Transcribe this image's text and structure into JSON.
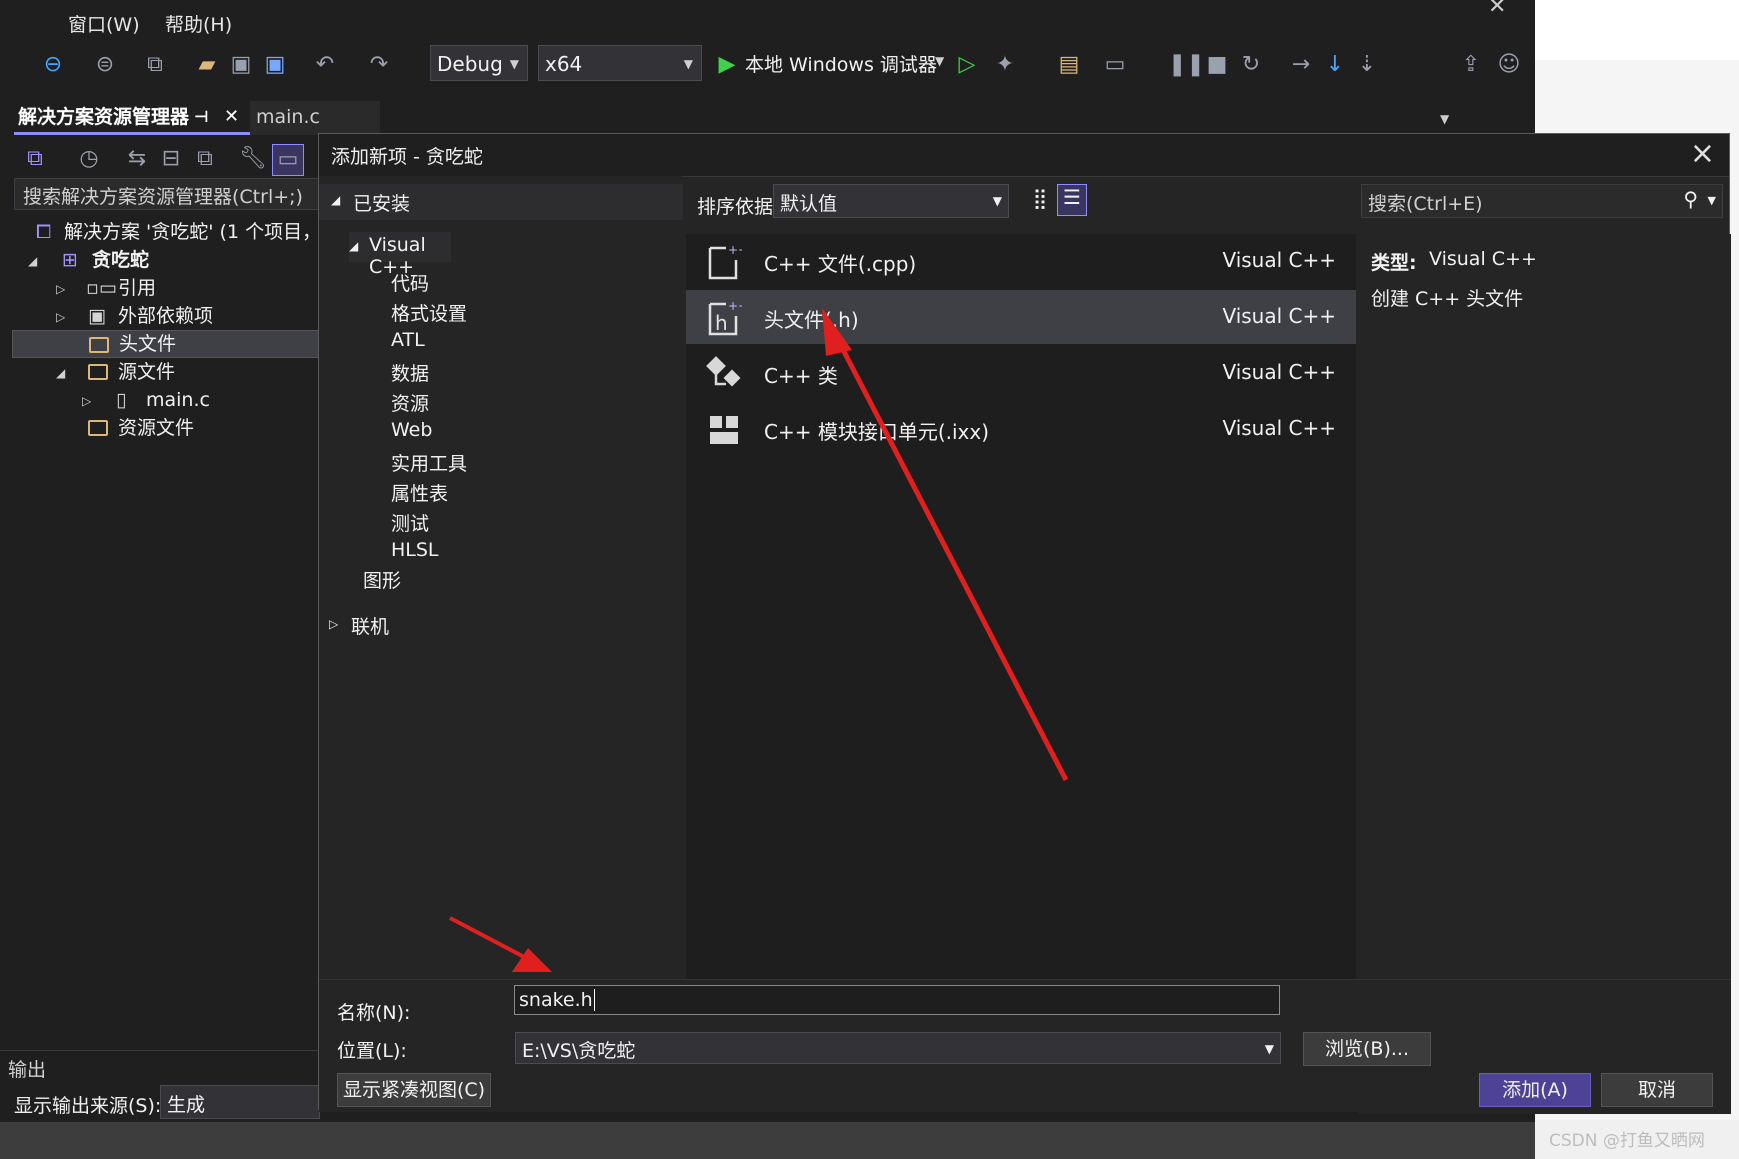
{
  "menu": {
    "window": "窗口(W)",
    "help": "帮助(H)"
  },
  "toolbar": {
    "config": "Debug",
    "platform": "x64",
    "debugger": "本地 Windows 调试器"
  },
  "solution_explorer": {
    "tab_title": "解决方案资源管理器",
    "tab_main": "main.c",
    "search_placeholder": "搜索解决方案资源管理器(Ctrl+;)",
    "tree": {
      "solution": "解决方案 '贪吃蛇' (1 个项目，共",
      "project": "贪吃蛇",
      "references": "引用",
      "external_deps": "外部依赖项",
      "header_files": "头文件",
      "source_files": "源文件",
      "main_c": "main.c",
      "resource_files": "资源文件"
    }
  },
  "output_panel": {
    "title": "输出",
    "source_label": "显示输出来源(S):",
    "source_value": "生成"
  },
  "dialog": {
    "title": "添加新项 - 贪吃蛇",
    "installed": "已安装",
    "categories": [
      "代码",
      "格式设置",
      "ATL",
      "数据",
      "资源",
      "Web",
      "实用工具",
      "属性表",
      "测试",
      "HLSL"
    ],
    "visual_cpp": "Visual C++",
    "graphics": "图形",
    "online": "联机",
    "sort_label": "排序依据:",
    "sort_value": "默认值",
    "search_placeholder": "搜索(Ctrl+E)",
    "items": [
      {
        "name": "C++ 文件(.cpp)",
        "lang": "Visual C++"
      },
      {
        "name": "头文件(.h)",
        "lang": "Visual C++"
      },
      {
        "name": "C++ 类",
        "lang": "Visual C++"
      },
      {
        "name": "C++ 模块接口单元(.ixx)",
        "lang": "Visual C++"
      }
    ],
    "desc_type_label": "类型:",
    "desc_type_value": "Visual C++",
    "desc_text": "创建 C++ 头文件",
    "name_label": "名称(N):",
    "name_value": "snake.h",
    "location_label": "位置(L):",
    "location_value": "E:\\VS\\贪吃蛇",
    "browse": "浏览(B)...",
    "compact_view": "显示紧凑视图(C)",
    "add": "添加(A)",
    "cancel": "取消"
  },
  "watermark": "CSDN @打鱼又晒网",
  "colors": {
    "accent": "#8f8cff",
    "primary_button": "#4d4295",
    "arrow": "#e0201e"
  }
}
